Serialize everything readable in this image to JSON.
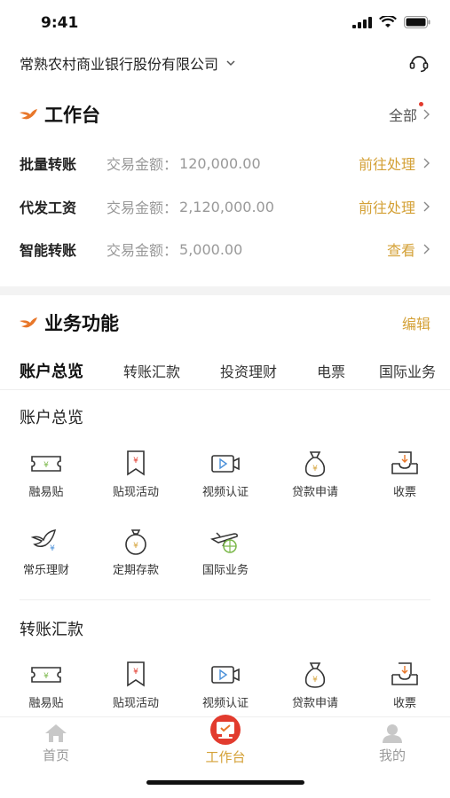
{
  "status": {
    "time": "9:41"
  },
  "org": {
    "name": "常熟农村商业银行股份有限公司"
  },
  "workbench": {
    "title": "工作台",
    "all_label": "全部",
    "tasks": [
      {
        "name": "批量转账",
        "amount_label": "交易金额：",
        "amount": "120,000.00",
        "action": "前往处理"
      },
      {
        "name": "代发工资",
        "amount_label": "交易金额：",
        "amount": "2,120,000.00",
        "action": "前往处理"
      },
      {
        "name": "智能转账",
        "amount_label": "交易金额：",
        "amount": "5,000.00",
        "action": "查看"
      }
    ]
  },
  "business": {
    "title": "业务功能",
    "edit_label": "编辑",
    "tabs": [
      "账户总览",
      "转账汇款",
      "投资理财",
      "电票",
      "国际业务"
    ],
    "groups": [
      {
        "title": "账户总览",
        "items": [
          {
            "label": "融易贴",
            "icon": "ticket-yen-icon"
          },
          {
            "label": "贴现活动",
            "icon": "bookmark-yen-icon"
          },
          {
            "label": "视频认证",
            "icon": "video-camera-icon"
          },
          {
            "label": "贷款申请",
            "icon": "money-bag-icon"
          },
          {
            "label": "收票",
            "icon": "inbox-download-icon"
          },
          {
            "label": "常乐理财",
            "icon": "bird-yen-icon"
          },
          {
            "label": "定期存款",
            "icon": "coin-bag-icon"
          },
          {
            "label": "国际业务",
            "icon": "plane-globe-icon"
          }
        ]
      },
      {
        "title": "转账汇款",
        "items": [
          {
            "label": "融易贴",
            "icon": "ticket-yen-icon"
          },
          {
            "label": "贴现活动",
            "icon": "bookmark-yen-icon"
          },
          {
            "label": "视频认证",
            "icon": "video-camera-icon"
          },
          {
            "label": "贷款申请",
            "icon": "money-bag-icon"
          },
          {
            "label": "收票",
            "icon": "inbox-download-icon"
          }
        ]
      }
    ]
  },
  "tabbar": [
    {
      "label": "首页",
      "icon": "home-icon",
      "active": false
    },
    {
      "label": "工作台",
      "icon": "workbench-icon",
      "active": true
    },
    {
      "label": "我的",
      "icon": "user-icon",
      "active": false
    }
  ],
  "colors": {
    "accent": "#d4a137",
    "brand_orange": "#e8772a",
    "brand_red": "#e23b2e",
    "green": "#7bb84a"
  }
}
